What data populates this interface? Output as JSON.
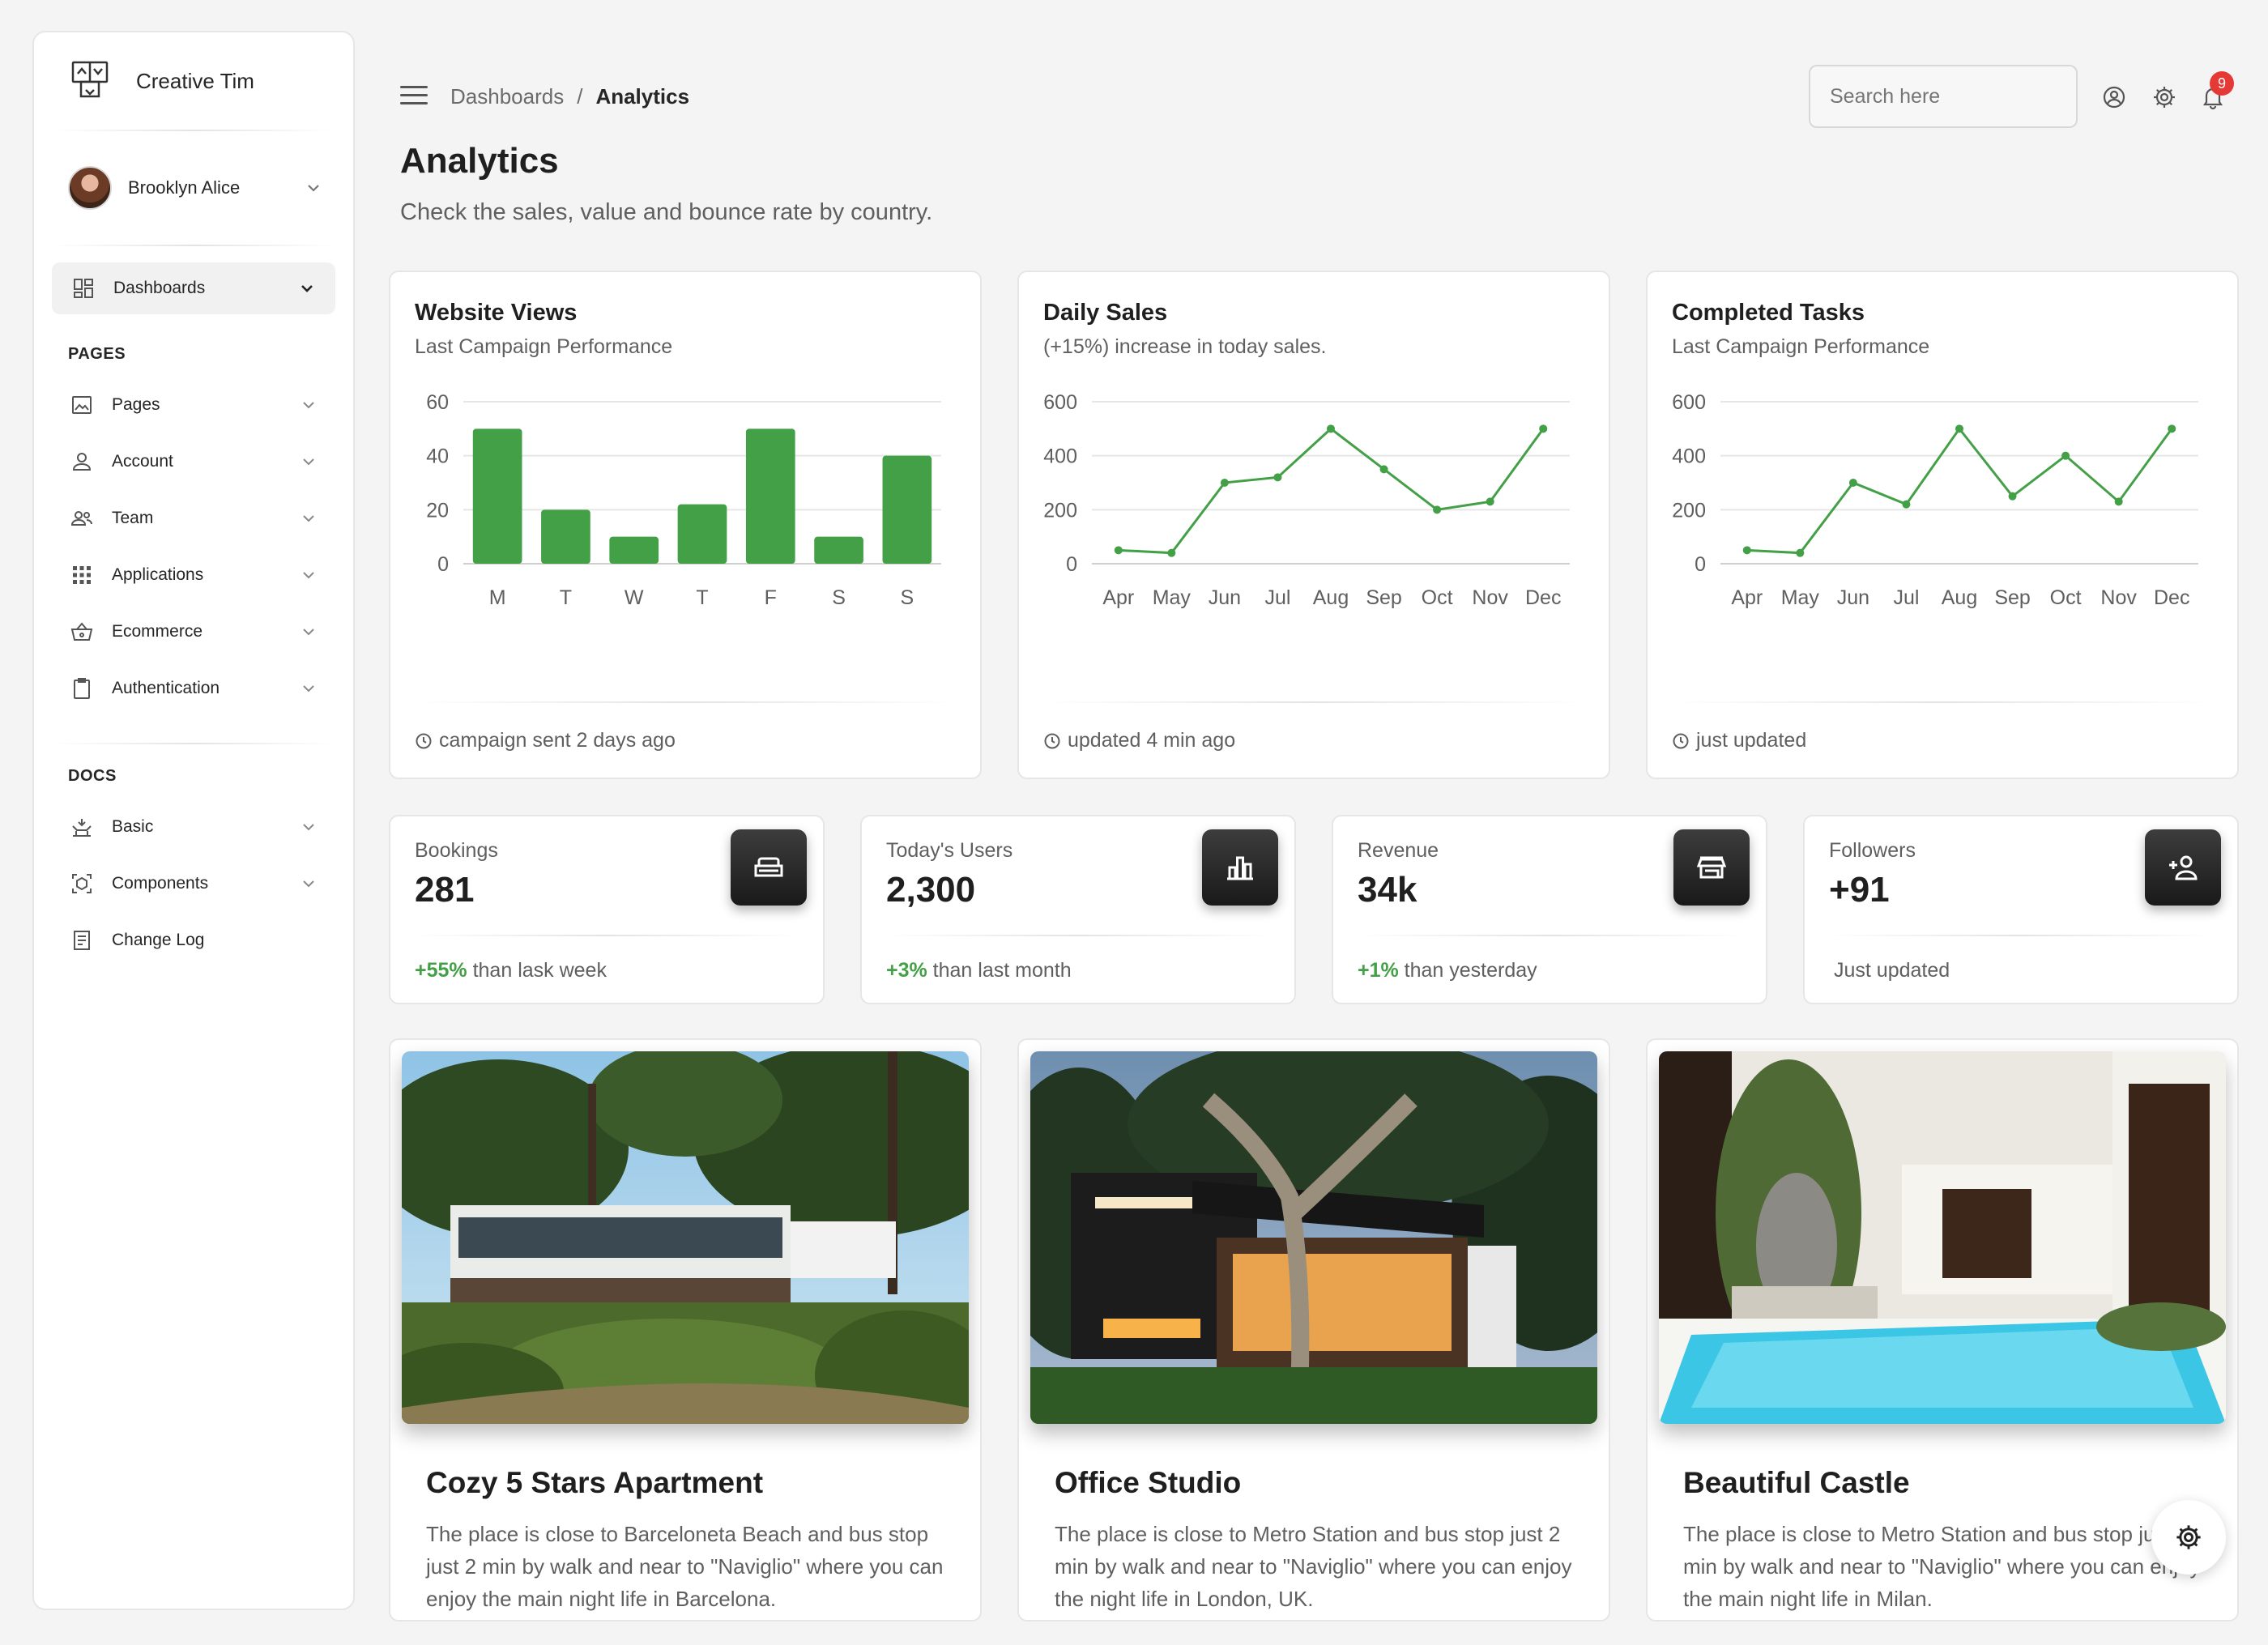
{
  "sidebar": {
    "brand": "Creative Tim",
    "user": "Brooklyn Alice",
    "dashboards": "Dashboards",
    "pages_title": "PAGES",
    "pages": [
      {
        "label": "Pages",
        "icon": "image-icon"
      },
      {
        "label": "Account",
        "icon": "user-icon"
      },
      {
        "label": "Team",
        "icon": "team-icon"
      },
      {
        "label": "Applications",
        "icon": "apps-grid-icon"
      },
      {
        "label": "Ecommerce",
        "icon": "basket-icon"
      },
      {
        "label": "Authentication",
        "icon": "clipboard-icon"
      }
    ],
    "docs_title": "DOCS",
    "docs": [
      {
        "label": "Basic",
        "icon": "basic-icon"
      },
      {
        "label": "Components",
        "icon": "components-icon"
      },
      {
        "label": "Change Log",
        "icon": "changelog-icon"
      }
    ]
  },
  "header": {
    "breadcrumb_root": "Dashboards",
    "breadcrumb_sep": "/",
    "breadcrumb_current": "Analytics",
    "search_placeholder": "Search here",
    "notification_count": "9"
  },
  "page": {
    "title": "Analytics",
    "subtitle": "Check the sales, value and bounce rate by country."
  },
  "charts": [
    {
      "title": "Website Views",
      "subtitle": "Last Campaign Performance",
      "footer": "campaign sent 2 days ago"
    },
    {
      "title": "Daily Sales",
      "subtitle": "(+15%) increase in today sales.",
      "footer": "updated 4 min ago"
    },
    {
      "title": "Completed Tasks",
      "subtitle": "Last Campaign Performance",
      "footer": "just updated"
    }
  ],
  "chart_data": [
    {
      "type": "bar",
      "title": "Website Views",
      "categories": [
        "M",
        "T",
        "W",
        "T",
        "F",
        "S",
        "S"
      ],
      "values": [
        50,
        20,
        10,
        22,
        50,
        10,
        40
      ],
      "yticks": [
        "0",
        "20",
        "40",
        "60"
      ],
      "ylim": [
        0,
        60
      ],
      "color": "#43a047"
    },
    {
      "type": "line",
      "title": "Daily Sales",
      "categories": [
        "Apr",
        "May",
        "Jun",
        "Jul",
        "Aug",
        "Sep",
        "Oct",
        "Nov",
        "Dec"
      ],
      "values": [
        50,
        40,
        300,
        320,
        500,
        350,
        200,
        230,
        500
      ],
      "yticks": [
        "0",
        "200",
        "400",
        "600"
      ],
      "ylim": [
        0,
        600
      ],
      "color": "#43a047"
    },
    {
      "type": "line",
      "title": "Completed Tasks",
      "categories": [
        "Apr",
        "May",
        "Jun",
        "Jul",
        "Aug",
        "Sep",
        "Oct",
        "Nov",
        "Dec"
      ],
      "values": [
        50,
        40,
        300,
        220,
        500,
        250,
        400,
        230,
        500
      ],
      "yticks": [
        "0",
        "200",
        "400",
        "600"
      ],
      "ylim": [
        0,
        600
      ],
      "color": "#43a047"
    }
  ],
  "stats": [
    {
      "label": "Bookings",
      "value": "281",
      "change": "+55%",
      "rest": " than lask week",
      "icon": "sofa-icon"
    },
    {
      "label": "Today's Users",
      "value": "2,300",
      "change": "+3%",
      "rest": " than last month",
      "icon": "leaderboard-icon"
    },
    {
      "label": "Revenue",
      "value": "34k",
      "change": "+1%",
      "rest": " than yesterday",
      "icon": "store-icon"
    },
    {
      "label": "Followers",
      "value": "+91",
      "change": "",
      "rest": "Just updated",
      "icon": "person-add-icon"
    }
  ],
  "properties": [
    {
      "title": "Cozy 5 Stars Apartment",
      "description": "The place is close to Barceloneta Beach and bus stop just 2 min by walk and near to \"Naviglio\" where you can enjoy the main night life in Barcelona."
    },
    {
      "title": "Office Studio",
      "description": "The place is close to Metro Station and bus stop just 2 min by walk and near to \"Naviglio\" where you can enjoy the night life in London, UK."
    },
    {
      "title": "Beautiful Castle",
      "description": "The place is close to Metro Station and bus stop just 2 min by walk and near to \"Naviglio\" where you can enjoy the main night life in Milan."
    }
  ]
}
